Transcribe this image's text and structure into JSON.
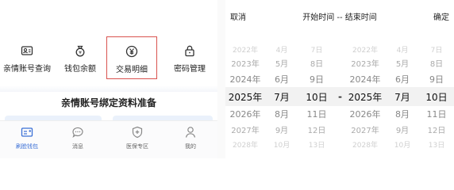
{
  "left": {
    "quick_actions": [
      {
        "label": "亲情账号查询",
        "icon": "account-card-icon",
        "highlighted": false
      },
      {
        "label": "钱包余额",
        "icon": "money-bag-icon",
        "highlighted": false
      },
      {
        "label": "交易明细",
        "icon": "yuan-icon",
        "highlighted": true
      },
      {
        "label": "密码管理",
        "icon": "lock-icon",
        "highlighted": false
      }
    ],
    "section_title": "亲情账号绑定资料准备",
    "tabs": [
      {
        "label": "刷脸钱包",
        "icon": "face-wallet-icon",
        "active": true
      },
      {
        "label": "消息",
        "icon": "message-icon",
        "active": false
      },
      {
        "label": "医保专区",
        "icon": "medical-shield-icon",
        "active": false
      },
      {
        "label": "我的",
        "icon": "user-icon",
        "active": false
      }
    ],
    "colors": {
      "active": "#3a6fd6",
      "highlight_border": "#d9534f"
    }
  },
  "picker": {
    "cancel_label": "取消",
    "title": "开始时间 -- 结束时间",
    "confirm_label": "确定",
    "range_separator": "-",
    "start": {
      "years": [
        "2022年",
        "2023年",
        "2024年",
        "2025年",
        "2026年",
        "2027年",
        "2028年"
      ],
      "months": [
        "4月",
        "5月",
        "6月",
        "7月",
        "8月",
        "9月",
        "10月"
      ],
      "days": [
        "7日",
        "8日",
        "9日",
        "10日",
        "11日",
        "12日",
        "13日"
      ]
    },
    "end": {
      "years": [
        "2022年",
        "2023年",
        "2024年",
        "2025年",
        "2026年",
        "2027年",
        "2028年"
      ],
      "months": [
        "4月",
        "5月",
        "6月",
        "7月",
        "8月",
        "9月",
        "10月"
      ],
      "days": [
        "7日",
        "8日",
        "9日",
        "10日",
        "11日",
        "12日",
        "13日"
      ]
    },
    "selected": {
      "year": "2025年",
      "month": "7月",
      "day": "10日"
    }
  }
}
